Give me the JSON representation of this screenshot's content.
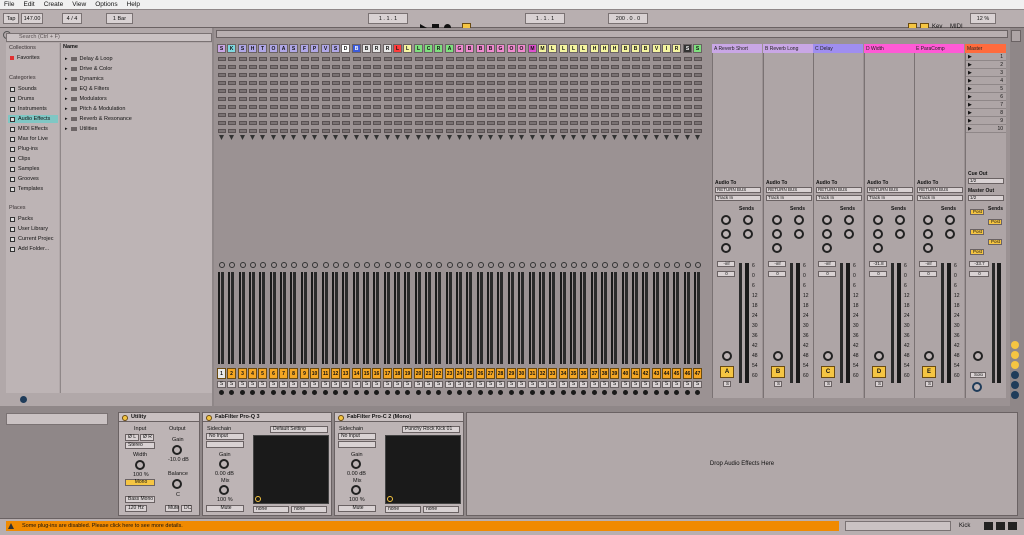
{
  "menu": [
    "File",
    "Edit",
    "Create",
    "View",
    "Options",
    "Help"
  ],
  "transport": {
    "tap": "Tap",
    "tempo": "147.00",
    "signature": "4 / 4",
    "quantize": "1 Bar",
    "position": "1 . 1 . 1",
    "loop_start": "1 . 1 . 1",
    "loop_length": "200 . 0 . 0",
    "key": "Key",
    "midi": "MIDI",
    "cpu": "12 %"
  },
  "browser": {
    "search_placeholder": "Search (Ctrl + F)",
    "collections_title": "Collections",
    "favorites": "Favorites",
    "categories_title": "Categories",
    "categories": [
      "Sounds",
      "Drums",
      "Instruments",
      "Audio Effects",
      "MIDI Effects",
      "Max for Live",
      "Plug-ins",
      "Clips",
      "Samples",
      "Grooves",
      "Templates"
    ],
    "selected_category": "Audio Effects",
    "places_title": "Places",
    "places": [
      "Packs",
      "User Library",
      "Current Projec",
      "Add Folder..."
    ],
    "name_header": "Name",
    "folders": [
      "Delay & Loop",
      "Drive & Color",
      "Dynamics",
      "EQ & Filters",
      "Modulators",
      "Pitch & Modulation",
      "Reverb & Resonance",
      "Utilities"
    ]
  },
  "tracks": {
    "headers": [
      "S",
      "K",
      "S",
      "H",
      "T",
      "O",
      "A",
      "S",
      "F",
      "P",
      "V",
      "S",
      "D",
      "B",
      "B",
      "R",
      "R",
      "L",
      "L",
      "L",
      "C",
      "R",
      "A",
      "G",
      "B",
      "B",
      "B",
      "G",
      "O",
      "O",
      "M",
      "M",
      "L",
      "L",
      "L",
      "L",
      "H",
      "H",
      "H",
      "B",
      "B",
      "B",
      "V",
      "I",
      "R",
      "S",
      "S"
    ],
    "colors": [
      "#c9a7e6",
      "#7fd9e0",
      "#b0a8e8",
      "#b0a8e8",
      "#b0a8e8",
      "#b0a8e8",
      "#b0a8e8",
      "#b0a8e8",
      "#b0a8e8",
      "#b0a8e8",
      "#b0a8e8",
      "#b0a8e8",
      "#ffffff",
      "#3b5bdb",
      "#e8e8e8",
      "#e8e8e8",
      "#e8e8e8",
      "#ff3b3b",
      "#f5f5a0",
      "#7ee07e",
      "#7ee07e",
      "#7ee07e",
      "#7ee07e",
      "#f08ad0",
      "#f08ad0",
      "#f08ad0",
      "#f08ad0",
      "#f08ad0",
      "#f08ad0",
      "#f08ad0",
      "#e04fd0",
      "#f5f5a0",
      "#f5f5a0",
      "#f5f5a0",
      "#f5f5a0",
      "#f5f5a0",
      "#f5f5a0",
      "#f5f5a0",
      "#f5f5a0",
      "#f5f5a0",
      "#f5f5a0",
      "#f5f5a0",
      "#f5f5a0",
      "#f5f5a0",
      "#f5f5a0",
      "#333333",
      "#7ee07e"
    ],
    "numbers": [
      "1",
      "2",
      "3",
      "4",
      "5",
      "6",
      "7",
      "8",
      "9",
      "10",
      "11",
      "12",
      "13",
      "14",
      "15",
      "16",
      "17",
      "18",
      "19",
      "20",
      "21",
      "22",
      "23",
      "24",
      "25",
      "26",
      "27",
      "28",
      "29",
      "30",
      "31",
      "32",
      "33",
      "34",
      "35",
      "36",
      "37",
      "38",
      "39",
      "40",
      "41",
      "42",
      "43",
      "44",
      "45",
      "46",
      "47",
      "48",
      "49"
    ],
    "solo_label": "S"
  },
  "returns": [
    {
      "header": "A Reverb Short",
      "color": "#c9a7e6",
      "letter": "A",
      "audio_to": "Audio To",
      "bus": "RETURN BUS",
      "input": "Track In",
      "sends": "Sends",
      "volume": "-inf",
      "pan": "0"
    },
    {
      "header": "B Reverb Long",
      "color": "#c9a7e6",
      "letter": "B",
      "audio_to": "Audio To",
      "bus": "RETURN BUS",
      "input": "Track In",
      "sends": "Sends",
      "volume": "-inf",
      "pan": "0"
    },
    {
      "header": "C Delay",
      "color": "#9f8ef0",
      "letter": "C",
      "audio_to": "Audio To",
      "bus": "RETURN BUS",
      "input": "Track In",
      "sends": "Sends",
      "volume": "-inf",
      "pan": "0"
    },
    {
      "header": "D Width",
      "color": "#ff5ad6",
      "letter": "D",
      "audio_to": "Audio To",
      "bus": "RETURN BUS",
      "input": "Track In",
      "sends": "Sends",
      "volume": "-31.8",
      "pan": "0"
    },
    {
      "header": "E ParaComp",
      "color": "#ff5ad6",
      "letter": "E",
      "audio_to": "Audio To",
      "bus": "RETURN BUS",
      "input": "Track In",
      "sends": "Sends",
      "volume": "-inf",
      "pan": "0"
    }
  ],
  "master": {
    "header": "Master",
    "color": "#ff6b3d",
    "scenes": [
      "1",
      "2",
      "3",
      "4",
      "5",
      "6",
      "7",
      "8",
      "9",
      "10"
    ],
    "cue_out": "Cue Out",
    "cue_value": "1/2",
    "master_out": "Master Out",
    "master_value": "1/2",
    "sends": "Sends",
    "post": "Post",
    "volume": "-33.7",
    "pan": "0",
    "solo": "Solo"
  },
  "meter_scale": [
    "6",
    "0",
    "6",
    "12",
    "18",
    "24",
    "30",
    "36",
    "42",
    "48",
    "54",
    "60"
  ],
  "devices": {
    "utility": {
      "title": "Utility",
      "input": "Input",
      "output": "Output",
      "phase_l": "Ø L",
      "phase_r": "Ø R",
      "stereo": "Stereo",
      "gain": "Gain",
      "gain_value": "-10.0 dB",
      "width": "Width",
      "width_value": "100 %",
      "mono": "Mono",
      "bass_mono": "Bass Mono",
      "bass_freq": "120 Hz",
      "balance": "Balance",
      "balance_value": "C",
      "mute": "Mute",
      "dc": "DC"
    },
    "proq": {
      "title": "FabFilter Pro-Q 3",
      "sidechain": "Sidechain",
      "sidechain_value": "No Input",
      "preset": "Default Setting",
      "gain": "Gain",
      "gain_value": "0.00 dB",
      "mix": "Mix",
      "mix_value": "100 %",
      "mute": "Mute",
      "none1": "none",
      "none2": "none"
    },
    "proc": {
      "title": "FabFilter Pro-C 2 (Mono)",
      "sidechain": "Sidechain",
      "sidechain_value": "No Input",
      "preset": "Punchy Rock Kick 01",
      "gain": "Gain",
      "gain_value": "0.00 dB",
      "mix": "Mix",
      "mix_value": "100 %",
      "mute": "Mute",
      "none1": "none",
      "none2": "none"
    },
    "drop_hint": "Drop Audio Effects Here"
  },
  "status": {
    "warning": "Some plug-ins are disabled. Please click here to see more details.",
    "track_label": "Kick"
  }
}
